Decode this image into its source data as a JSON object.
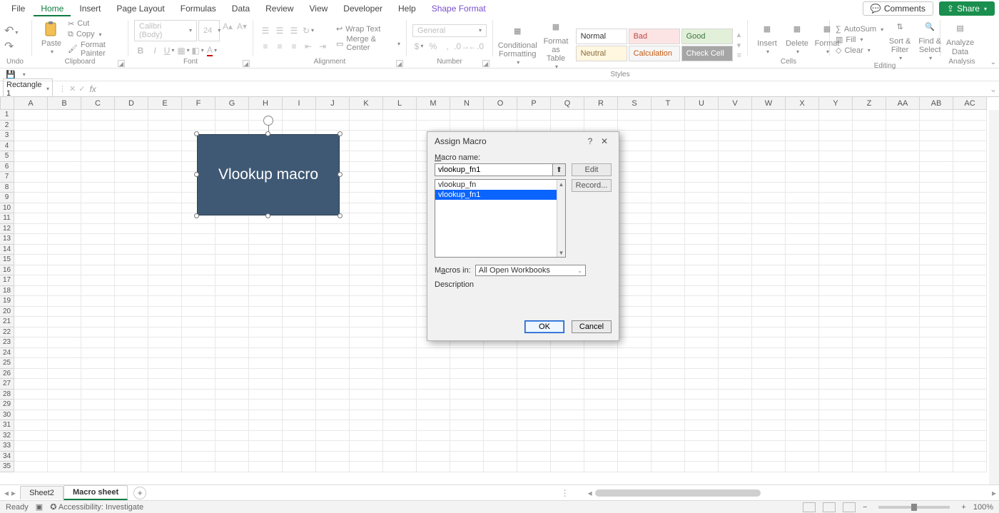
{
  "tabs": {
    "file": "File",
    "home": "Home",
    "insert": "Insert",
    "pagelayout": "Page Layout",
    "formulas": "Formulas",
    "data": "Data",
    "review": "Review",
    "view": "View",
    "developer": "Developer",
    "help": "Help",
    "shapeformat": "Shape Format"
  },
  "top_actions": {
    "comments": "Comments",
    "share": "Share"
  },
  "ribbon": {
    "undo": {
      "label": "Undo"
    },
    "clipboard": {
      "label": "Clipboard",
      "paste": "Paste",
      "cut": "Cut",
      "copy": "Copy",
      "painter": "Format Painter"
    },
    "font": {
      "label": "Font",
      "name": "Calibri (Body)",
      "size": "24"
    },
    "alignment": {
      "label": "Alignment",
      "wrap": "Wrap Text",
      "merge": "Merge & Center"
    },
    "number": {
      "label": "Number",
      "format": "General"
    },
    "styles": {
      "label": "Styles",
      "cond": "Conditional\nFormatting",
      "fat": "Format as\nTable",
      "normal": "Normal",
      "bad": "Bad",
      "good": "Good",
      "neutral": "Neutral",
      "calculation": "Calculation",
      "check": "Check Cell"
    },
    "cells": {
      "label": "Cells",
      "insert": "Insert",
      "delete": "Delete",
      "format": "Format"
    },
    "editing": {
      "label": "Editing",
      "autosum": "AutoSum",
      "fill": "Fill",
      "clear": "Clear",
      "sort": "Sort &\nFilter",
      "find": "Find &\nSelect"
    },
    "analysis": {
      "label": "Analysis",
      "analyze": "Analyze\nData"
    }
  },
  "namebox": "Rectangle 1",
  "formula": "",
  "columns": [
    "A",
    "B",
    "C",
    "D",
    "E",
    "F",
    "G",
    "H",
    "I",
    "J",
    "K",
    "L",
    "M",
    "N",
    "O",
    "P",
    "Q",
    "R",
    "S",
    "T",
    "U",
    "V",
    "W",
    "X",
    "Y",
    "Z",
    "AA",
    "AB",
    "AC"
  ],
  "rows": 35,
  "shape": {
    "text": "Vlookup macro"
  },
  "dialog": {
    "title": "Assign Macro",
    "macro_name_lbl": "Macro name:",
    "macro_name": "vlookup_fn1",
    "edit": "Edit",
    "record": "Record...",
    "list": [
      "vlookup_fn",
      "vlookup_fn1"
    ],
    "selected_index": 1,
    "macros_in_lbl": "Macros in:",
    "macros_in": "All Open Workbooks",
    "description_lbl": "Description",
    "ok": "OK",
    "cancel": "Cancel"
  },
  "sheet_tabs": {
    "s1": "Sheet2",
    "s2": "Macro sheet"
  },
  "status": {
    "ready": "Ready",
    "acc": "Accessibility: Investigate",
    "zoom": "100%"
  }
}
